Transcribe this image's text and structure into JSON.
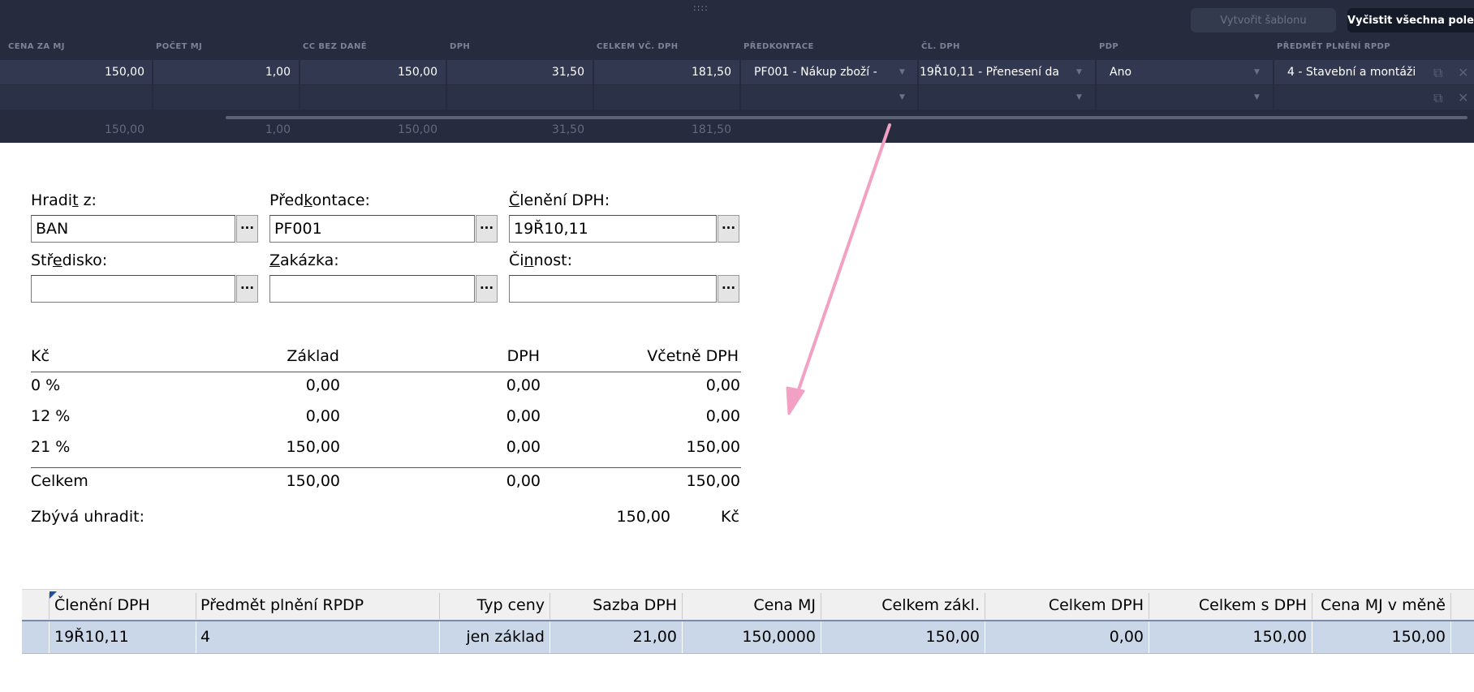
{
  "toolbar": {
    "drag_handle": "::::",
    "create_template": "Vytvořit šablonu",
    "clear_all": "Vyčistit všechna pole"
  },
  "grid": {
    "headers": [
      "CENA ZA MJ",
      "POČET MJ",
      "CC BEZ DANĚ",
      "DPH",
      "CELKEM VČ. DPH",
      "PŘEDKONTACE",
      "ČL. DPH",
      "PDP",
      "PŘEDMĚT PLNĚNÍ RPDP"
    ],
    "row1": {
      "unit_price": "150,00",
      "qty": "1,00",
      "net": "150,00",
      "vat": "31,50",
      "total": "181,50",
      "precontation": "PF001 - Nákup zboží -",
      "vat_class": "19Ř10,11 - Přenesení da",
      "pdp": "Ano",
      "rpdp_subject": "4 - Stavební a montáži"
    },
    "sums": [
      "150,00",
      "1,00",
      "150,00",
      "31,50",
      "181,50"
    ]
  },
  "form": {
    "hradit_z": {
      "label_pre": "Hradi",
      "label_acc": "t",
      "label_post": " z:",
      "value": "BAN"
    },
    "predkontace": {
      "label_pre": "Před",
      "label_acc": "k",
      "label_post": "ontace:",
      "value": "PF001"
    },
    "cleneni": {
      "label_pre": "",
      "label_acc": "Č",
      "label_post": "lenění DPH:",
      "value": "19Ř10,11"
    },
    "stredisko": {
      "label_pre": "Stř",
      "label_acc": "e",
      "label_post": "disko:",
      "value": ""
    },
    "zakazka": {
      "label_pre": "",
      "label_acc": "Z",
      "label_post": "akázka:",
      "value": ""
    },
    "cinnost": {
      "label_pre": "Či",
      "label_acc": "n",
      "label_post": "nost:",
      "value": ""
    },
    "ellipsis": "···"
  },
  "summary": {
    "headers": [
      "Kč",
      "Základ",
      "DPH",
      "Včetně DPH"
    ],
    "rows": [
      {
        "rate": "0 %",
        "base": "0,00",
        "vat": "0,00",
        "incl": "0,00"
      },
      {
        "rate": "12 %",
        "base": "0,00",
        "vat": "0,00",
        "incl": "0,00"
      },
      {
        "rate": "21 %",
        "base": "150,00",
        "vat": "0,00",
        "incl": "150,00"
      }
    ],
    "total": {
      "label": "Celkem",
      "base": "150,00",
      "vat": "0,00",
      "incl": "150,00"
    },
    "remaining": {
      "label": "Zbývá uhradit:",
      "value": "150,00",
      "currency": "Kč"
    }
  },
  "bottom_grid": {
    "headers": [
      "Členění DPH",
      "Předmět plnění RPDP",
      "Typ ceny",
      "Sazba DPH",
      "Cena MJ",
      "Celkem zákl.",
      "Celkem DPH",
      "Celkem s DPH",
      "Cena MJ v měně"
    ],
    "row": [
      "19Ř10,11",
      "4",
      "jen základ",
      "21,00",
      "150,0000",
      "150,00",
      "0,00",
      "150,00",
      "150,00"
    ]
  },
  "colors": {
    "dark_bg": "#262b3d",
    "row_bg": "#313850",
    "arrow": "#f2a0c4",
    "selected_row": "#c9d7e8"
  }
}
